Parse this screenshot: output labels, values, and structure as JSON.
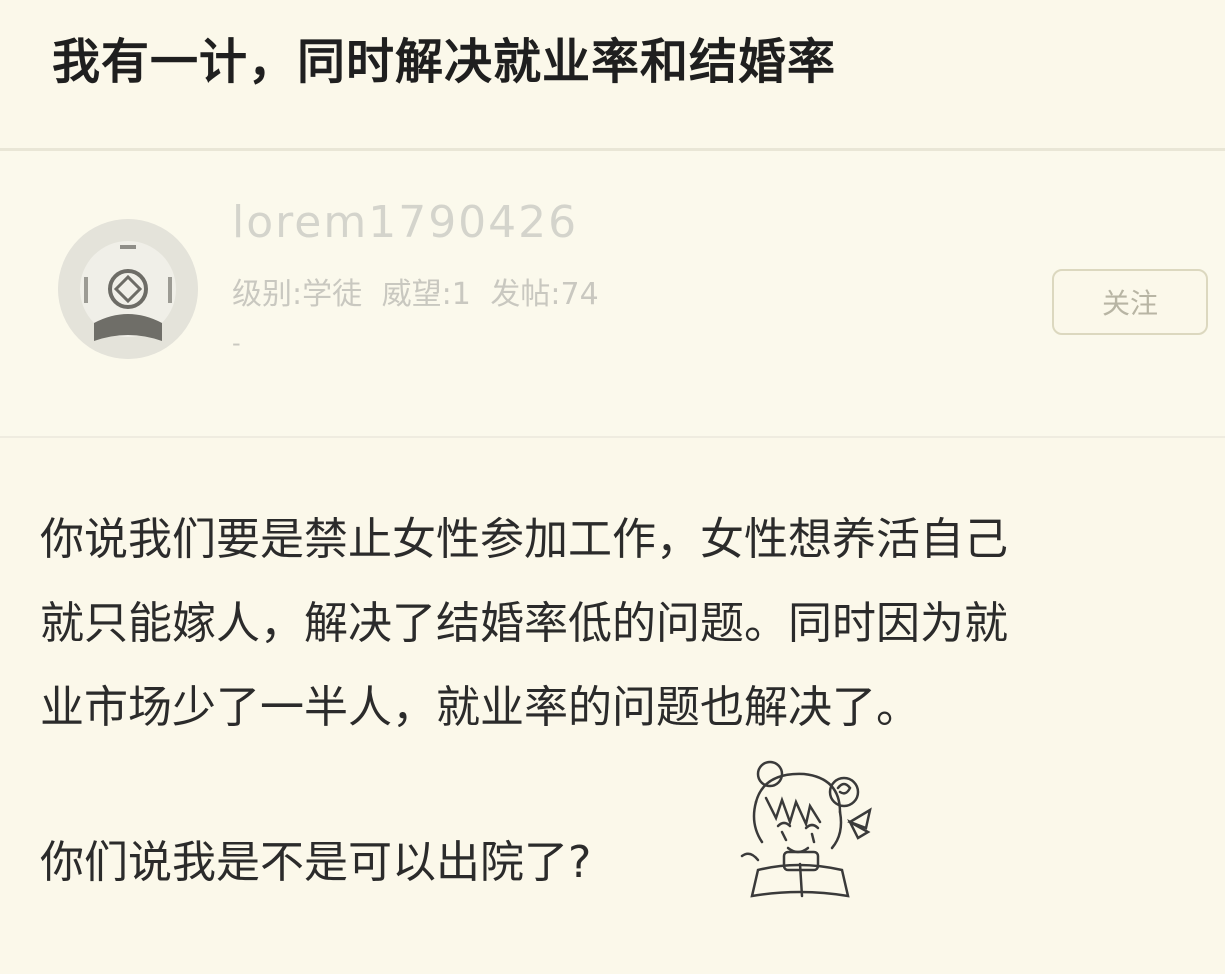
{
  "thread": {
    "title": "我有一计，同时解决就业率和结婚率"
  },
  "user": {
    "name": "lorem1790426",
    "level": "级别:学徒",
    "prestige": "威望:1",
    "posts": "发帖:74",
    "sub": "-",
    "follow_label": "关注",
    "avatar_icon": "default-avatar-icon"
  },
  "post": {
    "lines": [
      "你说我们要是禁止女性参加工作，女性想养活自己",
      "就只能嫁人，解决了结婚率低的问题。同时因为就",
      "业市场少了一半人，就业率的问题也解决了。"
    ],
    "question": "你们说我是不是可以出院了?",
    "sticker_icon": "anime-girl-sticker-icon"
  },
  "colors": {
    "background": "#fbf8ea",
    "title_text": "#1f1f1f",
    "body_text": "#2b2b2b",
    "muted_text": "#c9c8c0"
  }
}
